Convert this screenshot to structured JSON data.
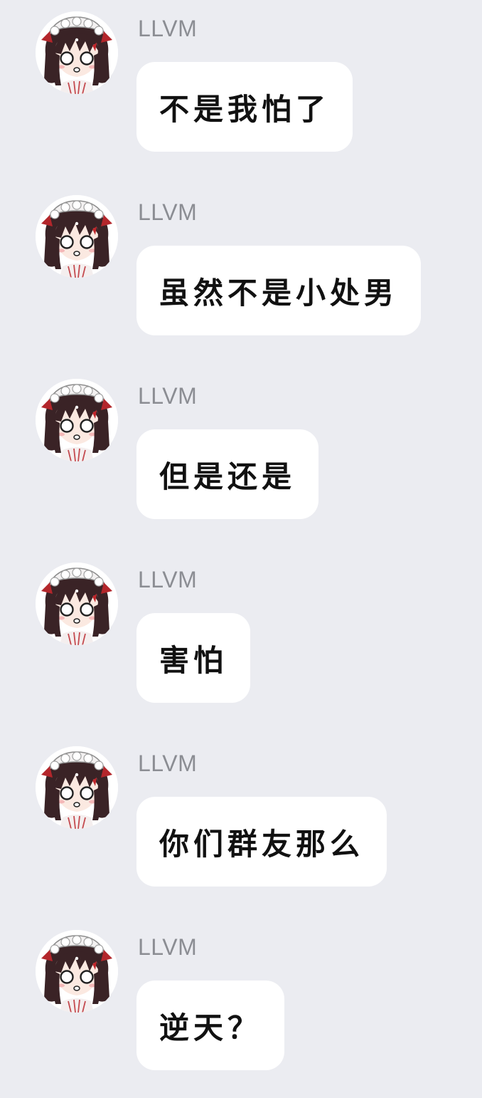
{
  "messages": [
    {
      "sender": "LLVM",
      "text": "不是我怕了"
    },
    {
      "sender": "LLVM",
      "text": "虽然不是小处男"
    },
    {
      "sender": "LLVM",
      "text": "但是还是"
    },
    {
      "sender": "LLVM",
      "text": "害怕"
    },
    {
      "sender": "LLVM",
      "text": "你们群友那么"
    },
    {
      "sender": "LLVM",
      "text": "逆天？"
    }
  ],
  "colors": {
    "background": "#ebecf1",
    "bubble": "#ffffff",
    "sender_name": "#8b8d93",
    "message_text": "#111111"
  },
  "icons": {
    "avatar": "anime-maid-girl-avatar"
  }
}
